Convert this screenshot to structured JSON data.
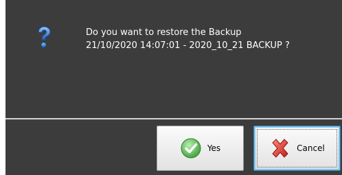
{
  "dialog": {
    "message_line1": "Do you want to restore the Backup",
    "message_line2": "21/10/2020 14:07:01 - 2020_10_21 BACKUP ?",
    "icon": "question-icon"
  },
  "buttons": {
    "yes_label": "Yes",
    "yes_icon": "check-icon",
    "cancel_label": "Cancel",
    "cancel_icon": "cross-icon"
  },
  "colors": {
    "background": "#3c3c3c",
    "text": "#ffffff",
    "question_blue": "#2b6fc4",
    "check_green": "#4caf50",
    "cross_red": "#d9322e",
    "focus_blue": "#7fc4ef"
  }
}
